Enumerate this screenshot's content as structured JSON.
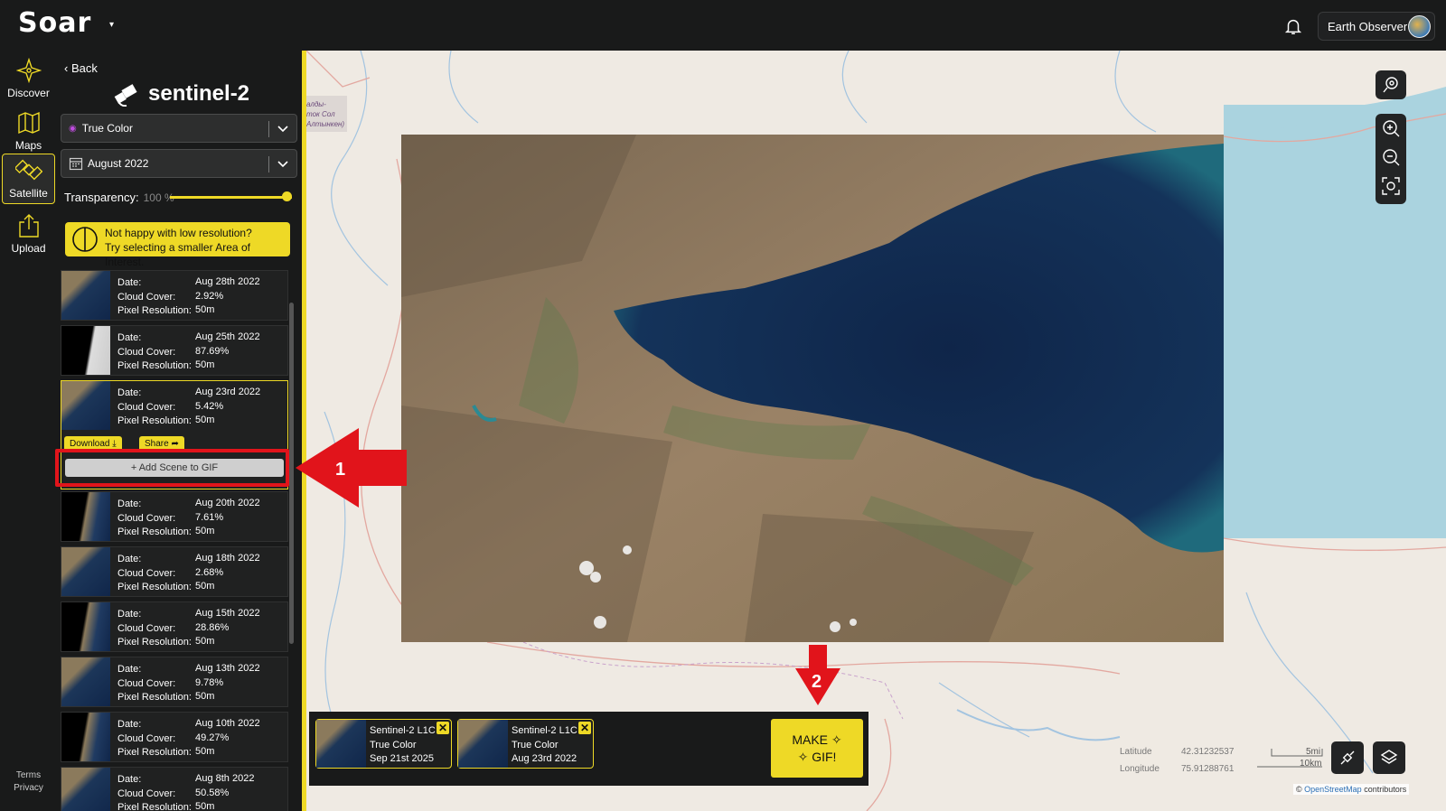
{
  "app": {
    "logo": "Soar",
    "logo_caret": "▾"
  },
  "header": {
    "user_name": "Earth Observer"
  },
  "rail": {
    "discover": "Discover",
    "maps": "Maps",
    "satellite": "Satellite",
    "upload": "Upload",
    "terms": "Terms",
    "privacy": "Privacy"
  },
  "panel": {
    "back": "Back",
    "title": "sentinel-2",
    "layer_select": "True Color",
    "date_select": "August 2022",
    "transparency_label": "Transparency:",
    "transparency_value": "100 %",
    "transparency_level": 1.0,
    "warning_line1": "Not happy with low resolution?",
    "warning_line2": "Try selecting a smaller Area of Interest.",
    "labels": {
      "date": "Date:",
      "cloud": "Cloud Cover:",
      "res": "Pixel Resolution:"
    },
    "download": "Download",
    "share": "Share",
    "add_scene": "+ Add Scene to GIF"
  },
  "scenes": [
    {
      "date": "Aug 28th 2022",
      "cloud": "2.92%",
      "res": "50m"
    },
    {
      "date": "Aug 25th 2022",
      "cloud": "87.69%",
      "res": "50m"
    },
    {
      "date": "Aug 23rd 2022",
      "cloud": "5.42%",
      "res": "50m"
    },
    {
      "date": "Aug 20th 2022",
      "cloud": "7.61%",
      "res": "50m"
    },
    {
      "date": "Aug 18th 2022",
      "cloud": "2.68%",
      "res": "50m"
    },
    {
      "date": "Aug 15th 2022",
      "cloud": "28.86%",
      "res": "50m"
    },
    {
      "date": "Aug 13th 2022",
      "cloud": "9.78%",
      "res": "50m"
    },
    {
      "date": "Aug 10th 2022",
      "cloud": "49.27%",
      "res": "50m"
    },
    {
      "date": "Aug 8th 2022",
      "cloud": "50.58%",
      "res": "50m"
    }
  ],
  "gif_tray": {
    "cards": [
      {
        "line1": "Sentinel-2 L1C",
        "line2": "True Color",
        "line3": "Sep 21st 2025"
      },
      {
        "line1": "Sentinel-2 L1C",
        "line2": "True Color",
        "line3": "Aug 23rd 2022"
      }
    ],
    "make_gif_line1": "MAKE",
    "make_gif_line2": "GIF!"
  },
  "map": {
    "place_label_1": "алды-",
    "place_label_2": "ток Сол",
    "place_label_3": "Алтынкен)",
    "latitude_label": "Latitude",
    "latitude_value": "42.31232537",
    "longitude_label": "Longitude",
    "longitude_value": "75.91288761",
    "scale_top": "5mi",
    "scale_bottom": "10km",
    "attribution_prefix": "©",
    "attribution_link": "OpenStreetMap",
    "attribution_suffix": "contributors"
  },
  "annotations": {
    "arrow1": "1",
    "arrow2": "2"
  },
  "colors": {
    "accent": "#eed926",
    "highlight_red": "#e1141b",
    "panel_bg": "#191a1a"
  }
}
